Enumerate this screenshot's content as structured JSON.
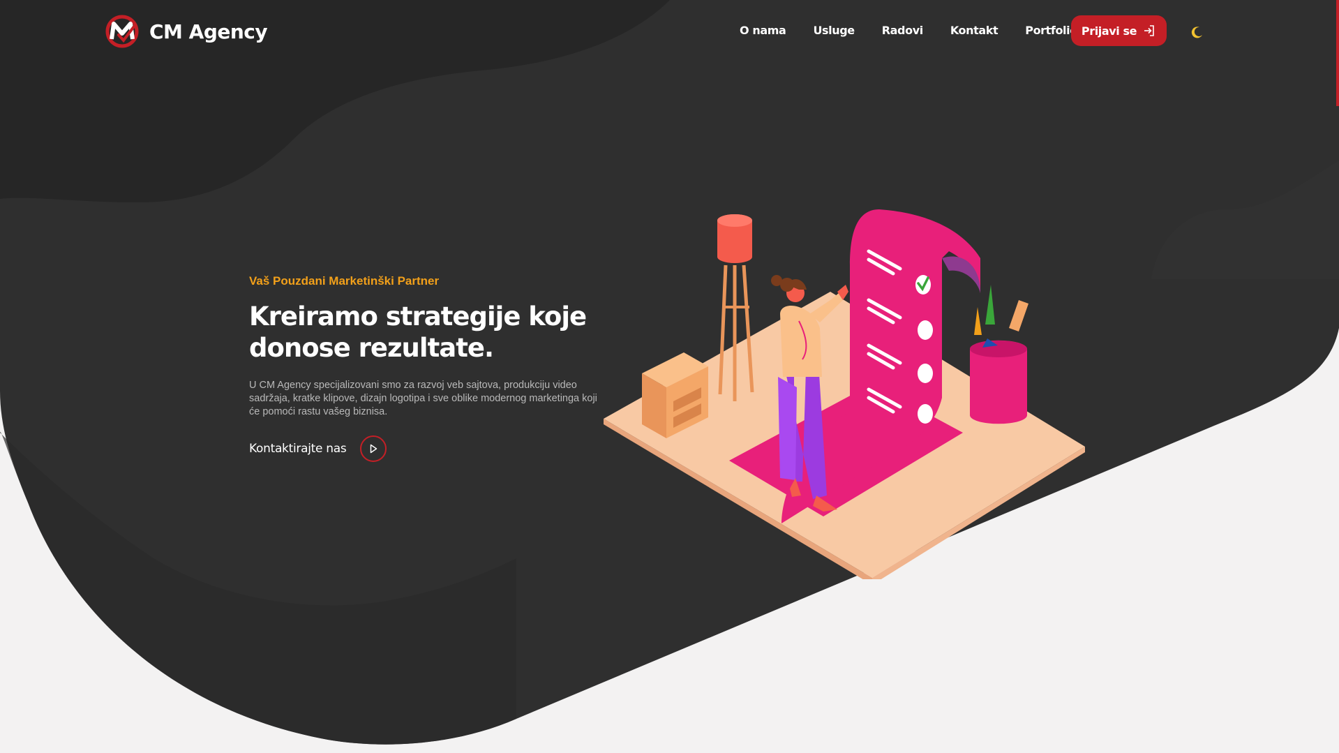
{
  "brand": {
    "name": "CM Agency",
    "logo_icon": "cm-logo-icon"
  },
  "nav": {
    "items": [
      "O nama",
      "Usluge",
      "Radovi",
      "Kontakt",
      "Portfolio"
    ]
  },
  "login_button": {
    "label": "Prijavi se",
    "icon": "sign-in-icon"
  },
  "theme_toggle": {
    "icon": "moon-icon"
  },
  "hero": {
    "eyebrow": "Vaš Pouzdani Marketinški Partner",
    "headline": "Kreiramo strategije koje donose rezultate.",
    "description": "U CM Agency specijalizovani smo za razvoj veb sajtova, produkciju video sadržaja, kratke klipove, dizajn logotipa i sve oblike modernog marketinga koji će pomoći rastu vašeg biznisa.",
    "cta_label": "Kontaktirajte nas",
    "cta_icon": "play-icon"
  },
  "colors": {
    "dark_bg": "#2f2f2f",
    "darker_bg": "#262626",
    "accent_red": "#c41f26",
    "accent_orange": "#f2a01a",
    "page_bg": "#f3f2f2"
  }
}
